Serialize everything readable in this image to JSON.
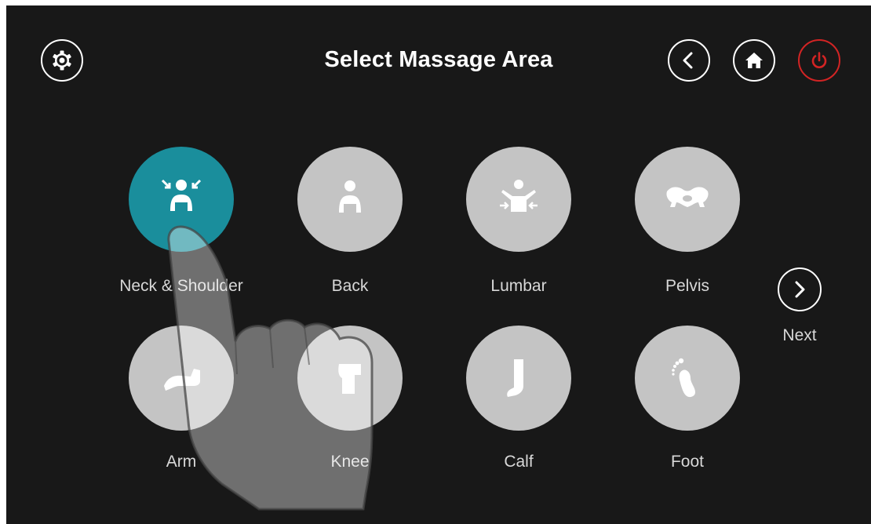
{
  "header": {
    "title": "Select Massage Area",
    "settings_icon": "gear-icon",
    "back_icon": "chevron-left-icon",
    "home_icon": "home-icon",
    "power_icon": "power-icon"
  },
  "areas": [
    {
      "label": "Neck & Shoulder",
      "icon": "neck-shoulder-icon",
      "selected": true
    },
    {
      "label": "Back",
      "icon": "back-icon",
      "selected": false
    },
    {
      "label": "Lumbar",
      "icon": "lumbar-icon",
      "selected": false
    },
    {
      "label": "Pelvis",
      "icon": "pelvis-icon",
      "selected": false
    },
    {
      "label": "Arm",
      "icon": "arm-icon",
      "selected": false
    },
    {
      "label": "Knee",
      "icon": "knee-icon",
      "selected": false
    },
    {
      "label": "Calf",
      "icon": "calf-icon",
      "selected": false
    },
    {
      "label": "Foot",
      "icon": "foot-icon",
      "selected": false
    }
  ],
  "pager": {
    "next_label": "Next",
    "icon": "chevron-right-icon"
  },
  "colors": {
    "background": "#181818",
    "tile": "#c4c4c4",
    "selected_tile": "#1a8e9c",
    "power": "#d32424",
    "text": "#ffffff"
  }
}
